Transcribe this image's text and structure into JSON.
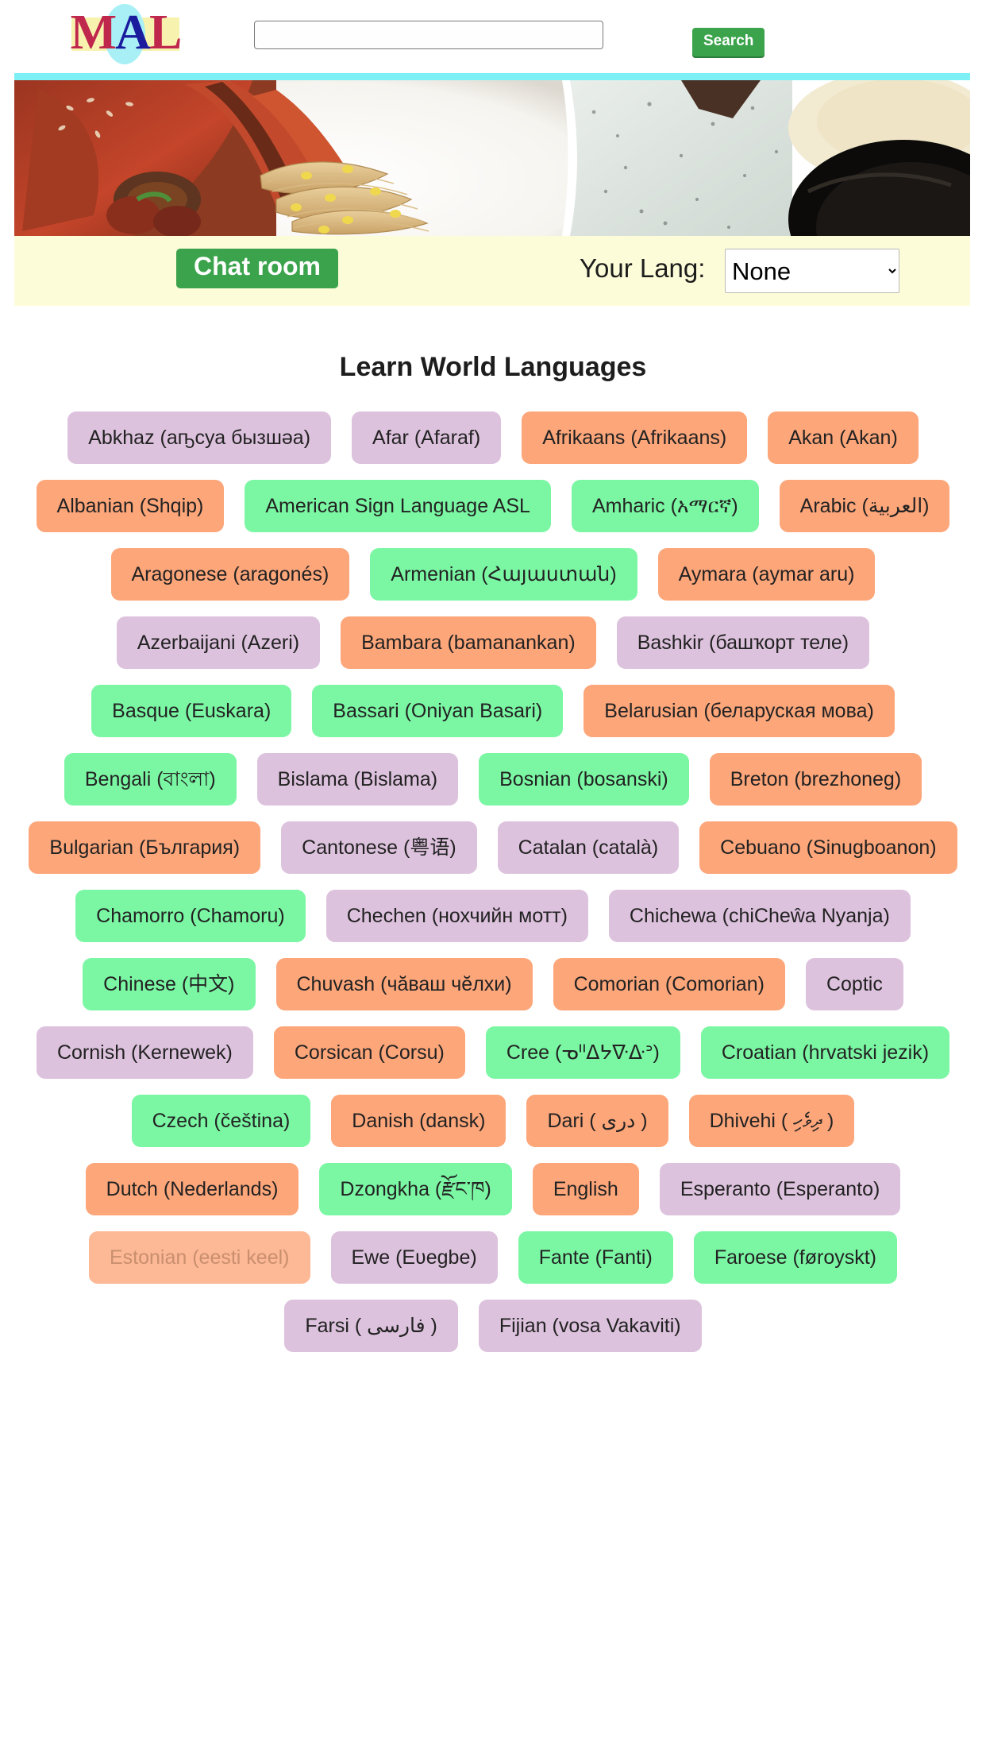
{
  "header": {
    "logo_text": "MAL",
    "logo_letters": [
      "M",
      "A",
      "L"
    ],
    "search_value": "",
    "search_placeholder": "",
    "search_button_label": "Search"
  },
  "banner": {
    "alt": "korean-food-banner-image"
  },
  "toolbar": {
    "chat_room_label": "Chat room",
    "your_lang_label": "Your Lang:",
    "lang_selected": "None",
    "lang_options": [
      "None"
    ]
  },
  "main": {
    "title": "Learn World Languages",
    "languages": [
      {
        "label": "Abkhaz (аҧсуа бызшәа)",
        "color": "purple"
      },
      {
        "label": "Afar (Afaraf)",
        "color": "purple"
      },
      {
        "label": "Afrikaans (Afrikaans)",
        "color": "orange"
      },
      {
        "label": "Akan (Akan)",
        "color": "orange"
      },
      {
        "label": "Albanian (Shqip)",
        "color": "orange"
      },
      {
        "label": "American Sign Language ASL",
        "color": "green"
      },
      {
        "label": "Amharic (አማርኛ)",
        "color": "green"
      },
      {
        "label": "Arabic (العربية)",
        "color": "orange"
      },
      {
        "label": "Aragonese (aragonés)",
        "color": "orange"
      },
      {
        "label": "Armenian (Հայաստան)",
        "color": "green"
      },
      {
        "label": "Aymara (aymar aru)",
        "color": "orange"
      },
      {
        "label": "Azerbaijani (Azeri)",
        "color": "purple"
      },
      {
        "label": "Bambara (bamanankan)",
        "color": "orange"
      },
      {
        "label": "Bashkir (башҡорт теле)",
        "color": "purple"
      },
      {
        "label": "Basque (Euskara)",
        "color": "green"
      },
      {
        "label": "Bassari (Oniyan Basari)",
        "color": "green"
      },
      {
        "label": "Belarusian (беларуская мова)",
        "color": "orange"
      },
      {
        "label": "Bengali (বাংলা)",
        "color": "green"
      },
      {
        "label": "Bislama (Bislama)",
        "color": "purple"
      },
      {
        "label": "Bosnian (bosanski)",
        "color": "green"
      },
      {
        "label": "Breton (brezhoneg)",
        "color": "orange"
      },
      {
        "label": "Bulgarian (България)",
        "color": "orange"
      },
      {
        "label": "Cantonese (粤语)",
        "color": "purple"
      },
      {
        "label": "Catalan (català)",
        "color": "purple"
      },
      {
        "label": "Cebuano (Sinugboanon)",
        "color": "orange"
      },
      {
        "label": "Chamorro (Chamoru)",
        "color": "green"
      },
      {
        "label": "Chechen (нохчийн мотт)",
        "color": "purple"
      },
      {
        "label": "Chichewa (chiCheŵa Nyanja)",
        "color": "purple"
      },
      {
        "label": "Chinese (中文)",
        "color": "green"
      },
      {
        "label": "Chuvash (чӑваш чӗлхи)",
        "color": "orange"
      },
      {
        "label": "Comorian (Comorian)",
        "color": "orange"
      },
      {
        "label": "Coptic",
        "color": "purple"
      },
      {
        "label": "Cornish (Kernewek)",
        "color": "purple"
      },
      {
        "label": "Corsican (Corsu)",
        "color": "orange"
      },
      {
        "label": "Cree (ᓀᐦᐃᔭᐍᐏᐣ)",
        "color": "green"
      },
      {
        "label": "Croatian (hrvatski jezik)",
        "color": "green"
      },
      {
        "label": "Czech (čeština)",
        "color": "green"
      },
      {
        "label": "Danish (dansk)",
        "color": "orange"
      },
      {
        "label": "Dari ( دری )",
        "color": "orange"
      },
      {
        "label": "Dhivehi ( ދިވެހި )",
        "color": "orange"
      },
      {
        "label": "Dutch (Nederlands)",
        "color": "orange"
      },
      {
        "label": "Dzongkha (རྫོང་ཁ)",
        "color": "green"
      },
      {
        "label": "English",
        "color": "orange"
      },
      {
        "label": "Esperanto (Esperanto)",
        "color": "purple"
      },
      {
        "label": "Estonian (eesti keel)",
        "color": "faded"
      },
      {
        "label": "Ewe (Eʋegbe)",
        "color": "purple"
      },
      {
        "label": "Fante (Fanti)",
        "color": "green"
      },
      {
        "label": "Faroese (føroyskt)",
        "color": "green"
      },
      {
        "label": "Farsi ( فارسی )",
        "color": "purple"
      },
      {
        "label": "Fijian (vosa Vakaviti)",
        "color": "purple"
      }
    ]
  },
  "colors": {
    "accent_green": "#3aa34c",
    "banner_strip_cyan": "#7df0f5",
    "toolbar_yellow": "#fdfcd9",
    "btn_purple": "#ddc2dd",
    "btn_orange": "#fda67a",
    "btn_green": "#7bf7a4",
    "logo_red": "#c0274d",
    "logo_blue": "#1b1b9e"
  }
}
